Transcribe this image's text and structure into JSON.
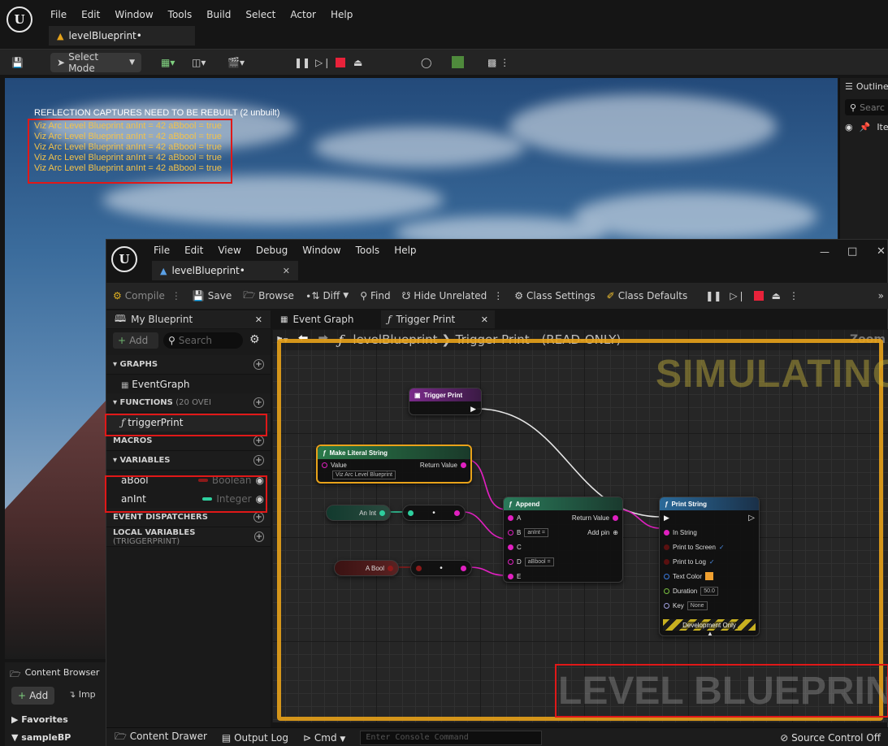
{
  "main_editor": {
    "menu": [
      "File",
      "Edit",
      "Window",
      "Tools",
      "Build",
      "Select",
      "Actor",
      "Help"
    ],
    "tab_title": "levelBlueprint•",
    "select_mode": "Select Mode",
    "outliner": {
      "title": "Outline",
      "search": "Searc",
      "col": "Ite"
    },
    "viewport_header": "REFLECTION CAPTURES NEED TO BE REBUILT (2 unbuilt)",
    "debug_lines": [
      "Viz Arc Level Blueprint anInt = 42 aBbool = true",
      "Viz Arc Level Blueprint anInt = 42 aBbool = true",
      "Viz Arc Level Blueprint anInt = 42 aBbool = true",
      "Viz Arc Level Blueprint anInt = 42 aBbool = true",
      "Viz Arc Level Blueprint anInt = 42 aBbool = true"
    ],
    "content_browser": {
      "title": "Content Browser",
      "add": "Add",
      "import": "Imp",
      "favorites": "Favorites",
      "folder": "sampleBP"
    }
  },
  "bp_editor": {
    "menu": [
      "File",
      "Edit",
      "View",
      "Debug",
      "Window",
      "Tools",
      "Help"
    ],
    "tab_title": "levelBlueprint•",
    "window_controls": {
      "minimize": "—",
      "maximize": "□",
      "close": "✕"
    },
    "toolbar": {
      "compile": "Compile",
      "save": "Save",
      "browse": "Browse",
      "diff": "Diff",
      "find": "Find",
      "hide_unrelated": "Hide Unrelated",
      "class_settings": "Class Settings",
      "class_defaults": "Class Defaults"
    },
    "my_blueprint": {
      "title": "My Blueprint",
      "add": "Add",
      "search": "Search",
      "graphs": "GRAPHS",
      "event_graph": "EventGraph",
      "functions": "FUNCTIONS",
      "functions_count": "(20 OVEI",
      "function_item": "triggerPrint",
      "macros": "MACROS",
      "variables": "VARIABLES",
      "vars": [
        {
          "name": "aBool",
          "type": "Boolean",
          "color": "#8c1a1a"
        },
        {
          "name": "anInt",
          "type": "Integer",
          "color": "#2ecf9e"
        }
      ],
      "event_dispatchers": "EVENT DISPATCHERS",
      "local_variables": "LOCAL VARIABLES",
      "local_variables_scope": "(TRIGGERPRINT)"
    },
    "graph_tabs": [
      "Event Graph",
      "Trigger Print"
    ],
    "breadcrumb": {
      "root": "levelBlueprint",
      "sep": "❯",
      "func": "Trigger Print",
      "mode": "(READ-ONLY)",
      "zoom": "Zoom"
    },
    "watermark_top": "SIMULATING",
    "watermark_bottom": "LEVEL BLUEPRINT",
    "nodes": {
      "trigger": "Trigger Print",
      "make_literal": {
        "title": "Make Literal String",
        "value_label": "Value",
        "value": "Viz Arc Level Blueprint",
        "return": "Return Value"
      },
      "an_int": "An Int",
      "a_bool": "A Bool",
      "append": {
        "title": "Append",
        "a": "A",
        "b": "B",
        "b_val": "anInt =",
        "c": "C",
        "d": "D",
        "d_val": "aBbool =",
        "e": "E",
        "return": "Return Value",
        "add_pin": "Add pin"
      },
      "print_string": {
        "title": "Print String",
        "in_string": "In String",
        "print_screen": "Print to Screen",
        "print_log": "Print to Log",
        "text_color": "Text Color",
        "duration": "Duration",
        "duration_val": "50.0",
        "key": "Key",
        "key_val": "None",
        "dev_only": "Development Only"
      }
    },
    "status": {
      "content_drawer": "Content Drawer",
      "output_log": "Output Log",
      "cmd": "Cmd",
      "console_placeholder": "Enter Console Command",
      "source_control": "Source Control Off"
    }
  },
  "colors": {
    "highlight": "#e01818",
    "simulating_border": "#e8a21a",
    "exec_wire": "#e6e6e6",
    "string_wire": "#e020c0"
  }
}
